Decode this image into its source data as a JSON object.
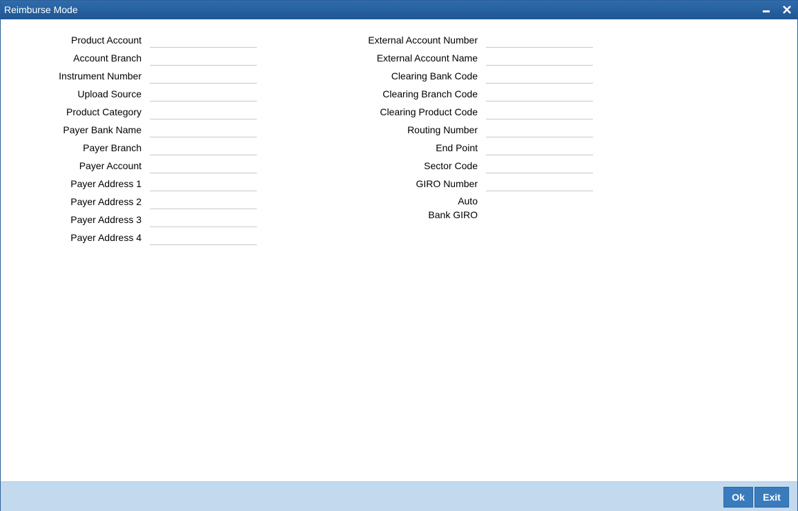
{
  "window": {
    "title": "Reimburse Mode"
  },
  "left_fields": [
    {
      "label": "Product Account",
      "value": ""
    },
    {
      "label": "Account Branch",
      "value": ""
    },
    {
      "label": "Instrument Number",
      "value": ""
    },
    {
      "label": "Upload Source",
      "value": ""
    },
    {
      "label": "Product Category",
      "value": ""
    },
    {
      "label": "Payer Bank Name",
      "value": ""
    },
    {
      "label": "Payer Branch",
      "value": ""
    },
    {
      "label": "Payer Account",
      "value": ""
    },
    {
      "label": "Payer Address 1",
      "value": ""
    },
    {
      "label": "Payer Address 2",
      "value": ""
    },
    {
      "label": "Payer Address 3",
      "value": ""
    },
    {
      "label": "Payer Address 4",
      "value": ""
    }
  ],
  "right_fields": [
    {
      "label": "External Account Number",
      "value": ""
    },
    {
      "label": "External Account Name",
      "value": ""
    },
    {
      "label": "Clearing Bank Code",
      "value": ""
    },
    {
      "label": "Clearing Branch Code",
      "value": ""
    },
    {
      "label": "Clearing Product Code",
      "value": ""
    },
    {
      "label": "Routing Number",
      "value": ""
    },
    {
      "label": "End Point",
      "value": ""
    },
    {
      "label": "Sector Code",
      "value": ""
    },
    {
      "label": "GIRO Number",
      "value": ""
    }
  ],
  "auto_bank_giro": {
    "line1": "Auto",
    "line2": "Bank GIRO"
  },
  "footer": {
    "ok_label": "Ok",
    "exit_label": "Exit"
  }
}
